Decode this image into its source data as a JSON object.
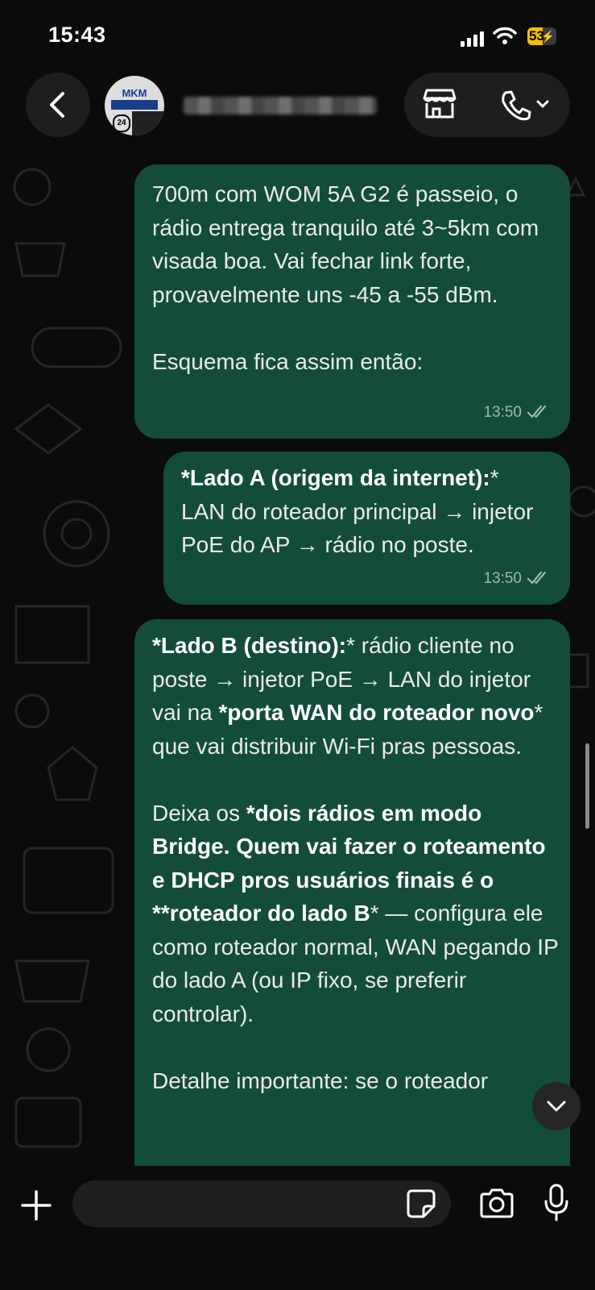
{
  "status_bar": {
    "time": "15:43",
    "battery_percent": "53",
    "battery_level": 0.53
  },
  "header": {
    "back_icon": "chevron-left-icon",
    "avatar_text": "MKM",
    "avatar_badge": "24",
    "contact_name": "",
    "store_icon": "store-icon",
    "call_icon": "phone-icon"
  },
  "messages": [
    {
      "text": "700m com WOM 5A G2 é passeio, o rádio entrega tranquilo até 3~5km com visada boa. Vai fechar link forte, provavelmente uns -45 a -55 dBm.\n\nEsquema fica assim então:",
      "time": "13:50",
      "status": "read"
    },
    {
      "bold": "*Lado A (origem da internet):",
      "text": "*\nLAN do roteador principal → injetor PoE do AP → rádio no poste.",
      "time": "13:50",
      "status": "read"
    },
    {
      "parts": [
        {
          "b": "*Lado B (destino):"
        },
        {
          "t": "* rádio cliente no poste → injetor PoE → LAN do injetor vai na "
        },
        {
          "b": "*porta WAN do roteador novo"
        },
        {
          "t": "* que vai distribuir Wi-Fi pras pessoas.\n\nDeixa os "
        },
        {
          "b": "*dois rádios em modo Bridge. Quem vai fazer o roteamento e DHCP pros usuários finais é o **roteador do lado B"
        },
        {
          "t": "* — configura ele como roteador normal, WAN pegando IP do lado A (ou IP fixo, se preferir controlar).\n\nDetalhe importante: se o roteador"
        }
      ]
    }
  ],
  "composer": {
    "placeholder": "",
    "icons": [
      "plus-icon",
      "sticker-icon",
      "camera-icon",
      "microphone-icon"
    ]
  },
  "colors": {
    "bubble": "#144d37",
    "background": "#0b0b0b",
    "timestamp": "#9fb9ad"
  }
}
